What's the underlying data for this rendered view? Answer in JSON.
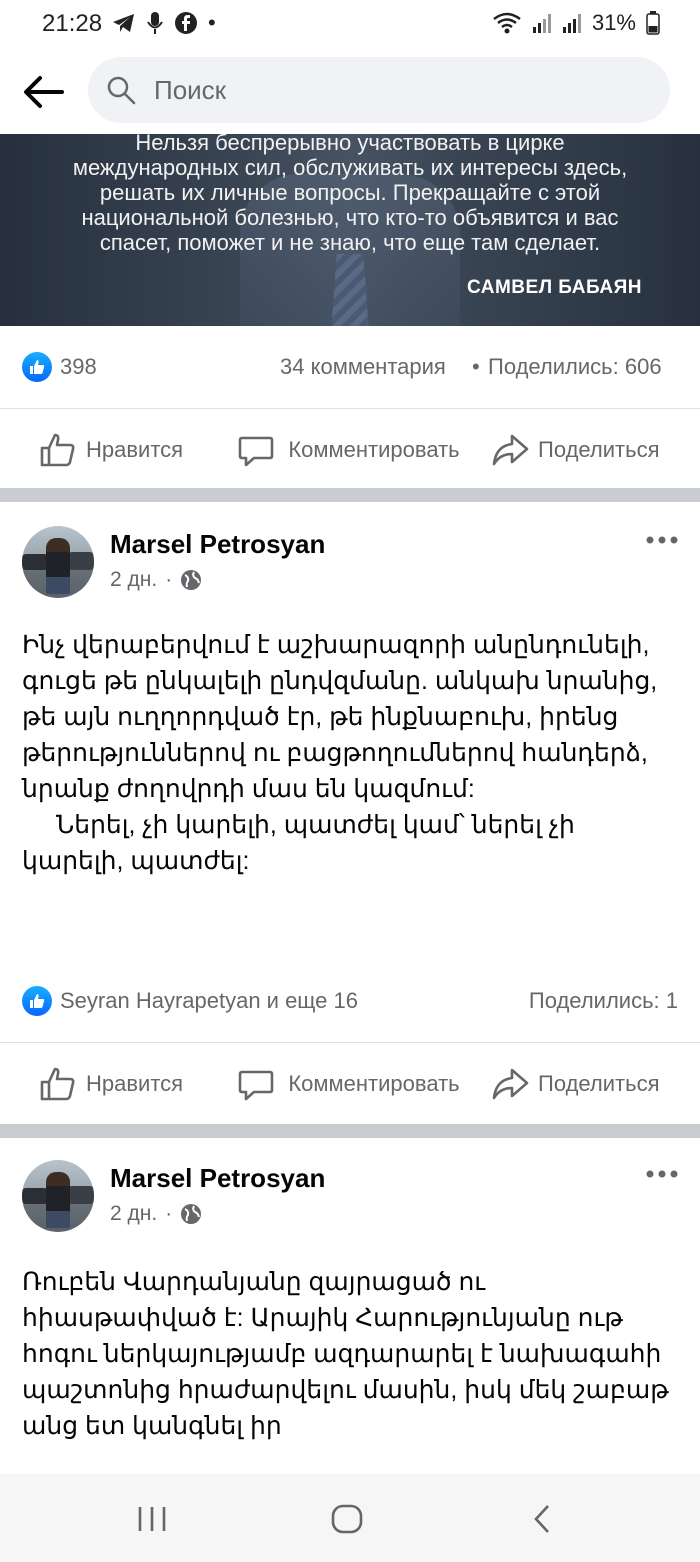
{
  "status_bar": {
    "time": "21:28",
    "battery": "31%",
    "left_icons": [
      "telegram-icon",
      "microphone-icon",
      "facebook-icon",
      "dot-icon"
    ],
    "right_icons": [
      "wifi-icon",
      "signal-icon",
      "signal-icon",
      "battery-icon"
    ]
  },
  "search": {
    "placeholder": "Поиск"
  },
  "quote_image": {
    "lines": [
      "Нельзя беспрерывно участвовать в цирке",
      "международных сил, обслуживать их интересы здесь,",
      "решать их личные вопросы. Прекращайте с этой",
      "национальной болезнью, что кто-то объявится и вас",
      "спасет, поможет и не знаю, что еще там сделает."
    ],
    "author": "САМВЕЛ БАБАЯН"
  },
  "post1_stats": {
    "likes": "398",
    "comments": "34 комментария",
    "separator": "•",
    "shares": "Поделились: 606"
  },
  "actions": {
    "like": "Нравится",
    "comment": "Комментировать",
    "share": "Поделиться"
  },
  "post2": {
    "author": "Marsel Petrosyan",
    "time": "2 дн.",
    "separator": "·",
    "body": [
      "Ինչ վերաբերվում է աշխարազորի անընդունելի, գուցե թե ընկալելի ընդվզմանը. անկախ նրանից, թե այն ուղղորդված էր, թե ինքնաբուխ, իրենց թերություններով ու բացթողումներով հանդերձ, նրանք ժողովրդի մաս են կազմում:",
      "Ներել, չի կարելի, պատժել կամ՝ ներել չի կարելի, պատժել:"
    ],
    "reactions": "Seyran Hayrapetyan и еще 16",
    "shares": "Поделились: 1"
  },
  "post3": {
    "author": "Marsel Petrosyan",
    "time": "2 дн.",
    "separator": "·",
    "body": "Ռուբեն Վարդանյանը զայրացած ու հիասթափված է: Արայիկ Հարությունյանը ութ հոգու ներկայությամբ ազդարարել է նախագահի պաշտոնից հրաժարվելու մասին, իսկ մեկ շաբաթ անց ետ կանգնել իր"
  },
  "colors": {
    "facebook_blue": "#0866ff",
    "secondary_text": "#65676b",
    "divider": "#c9ccd1"
  }
}
